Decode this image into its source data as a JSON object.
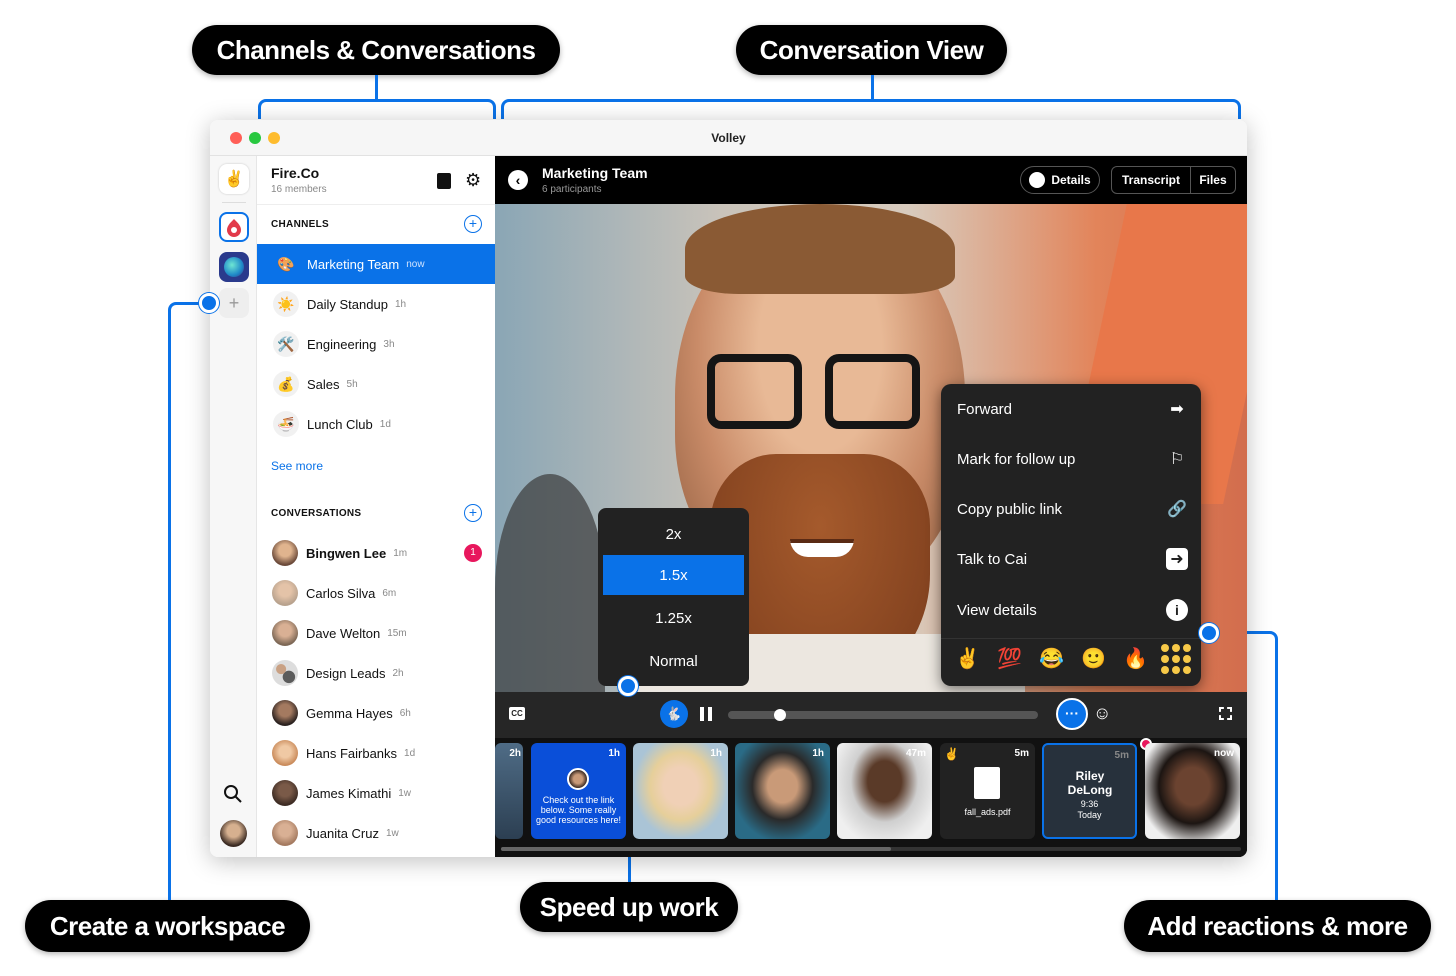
{
  "callouts": {
    "channels": "Channels & Conversations",
    "conversation_view": "Conversation View",
    "create_workspace": "Create a workspace",
    "speed_up": "Speed up work",
    "reactions": "Add reactions & more"
  },
  "window": {
    "title": "Volley"
  },
  "workspace": {
    "name": "Fire.Co",
    "members": "16 members"
  },
  "channels": {
    "heading": "CHANNELS",
    "items": [
      {
        "label": "Marketing Team",
        "time": "now",
        "emoji": "🎨",
        "selected": true
      },
      {
        "label": "Daily Standup",
        "time": "1h",
        "emoji": "☀️"
      },
      {
        "label": "Engineering",
        "time": "3h",
        "emoji": "🛠️"
      },
      {
        "label": "Sales",
        "time": "5h",
        "emoji": "💰"
      },
      {
        "label": "Lunch Club",
        "time": "1d",
        "emoji": "🍜"
      }
    ],
    "see_more": "See more"
  },
  "conversations": {
    "heading": "CONVERSATIONS",
    "items": [
      {
        "label": "Bingwen Lee",
        "time": "1m",
        "badge": "1",
        "color": "#6b4a3a"
      },
      {
        "label": "Carlos Silva",
        "time": "6m",
        "color": "#b8a28e"
      },
      {
        "label": "Dave Welton",
        "time": "15m",
        "color": "#7d6856"
      },
      {
        "label": "Design Leads",
        "time": "2h",
        "color": "#5c5c5c"
      },
      {
        "label": "Gemma Hayes",
        "time": "6h",
        "color": "#4a3a34"
      },
      {
        "label": "Hans Fairbanks",
        "time": "1d",
        "color": "#c98a5a"
      },
      {
        "label": "James Kimathi",
        "time": "1w",
        "color": "#3d2c24"
      },
      {
        "label": "Juanita Cruz",
        "time": "1w",
        "color": "#a47a60"
      }
    ]
  },
  "header": {
    "title": "Marketing Team",
    "subtitle": "6 participants",
    "details": "Details",
    "transcript": "Transcript",
    "files": "Files"
  },
  "menu": {
    "items": [
      "Forward",
      "Mark for follow up",
      "Copy public link",
      "Talk to Cai",
      "View details"
    ],
    "reactions": [
      "✌️",
      "💯",
      "😂",
      "🙂",
      "🔥"
    ]
  },
  "speed": {
    "options": [
      "2x",
      "1.5x",
      "1.25x",
      "Normal"
    ],
    "selected": "1.5x"
  },
  "controls": {
    "cc": "CC",
    "progress": 0.07
  },
  "thumbs": [
    {
      "time": "2h"
    },
    {
      "time": "1h",
      "text": "Check out the link below. Some really good resources here!"
    },
    {
      "time": "1h"
    },
    {
      "time": "1h"
    },
    {
      "time": "47m"
    },
    {
      "time": "5m",
      "file": "fall_ads.pdf",
      "emoji": "✌️"
    },
    {
      "time": "5m",
      "name": "Riley DeLong",
      "clock": "9:36",
      "day": "Today"
    },
    {
      "time": "now"
    }
  ],
  "colors": {
    "accent": "#0a72e8",
    "badge": "#e8175d"
  }
}
